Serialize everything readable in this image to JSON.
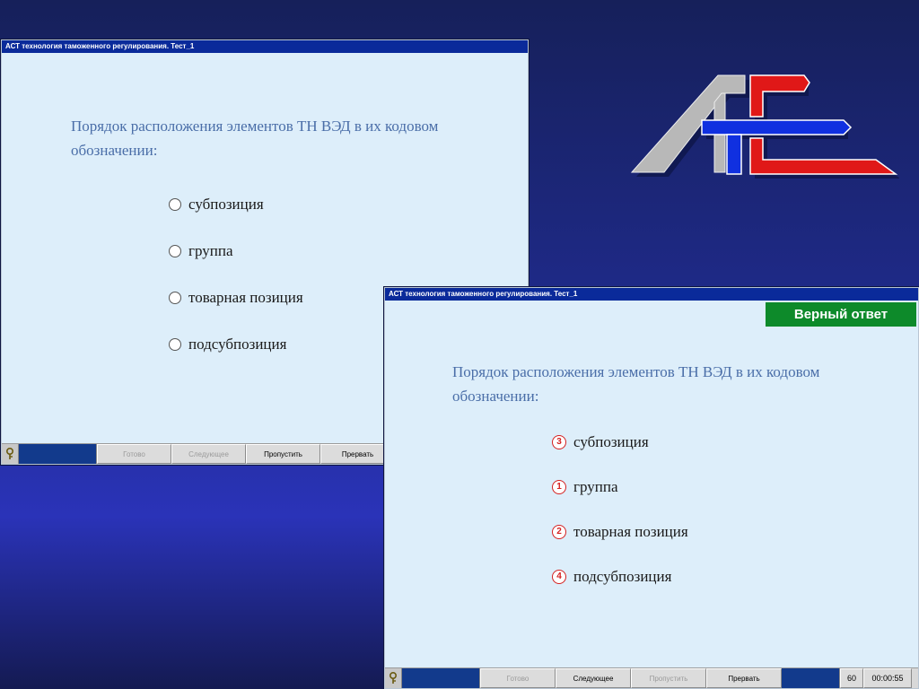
{
  "window1": {
    "title": "АСТ  технология таможенного регулирования. Тест_1",
    "question": "Порядок расположения элементов ТН ВЭД в их кодовом обозначении:",
    "options": [
      {
        "label": "субпозиция"
      },
      {
        "label": "группа"
      },
      {
        "label": "товарная позиция"
      },
      {
        "label": "подсубпозиция"
      }
    ],
    "statusbar": {
      "help_icon": "key-icon",
      "buttons": [
        {
          "label": "Готово",
          "enabled": false
        },
        {
          "label": "Следующее",
          "enabled": false
        },
        {
          "label": "Пропустить",
          "enabled": true
        },
        {
          "label": "Прервать",
          "enabled": true
        }
      ]
    }
  },
  "window2": {
    "title": "АСТ  технология таможенного регулирования. Тест_1",
    "result_banner": "Верный ответ",
    "question": "Порядок расположения элементов ТН ВЭД в их кодовом обозначении:",
    "options": [
      {
        "order": "3",
        "label": "субпозиция"
      },
      {
        "order": "1",
        "label": "группа"
      },
      {
        "order": "2",
        "label": "товарная позиция"
      },
      {
        "order": "4",
        "label": "подсубпозиция"
      }
    ],
    "statusbar": {
      "help_icon": "key-icon",
      "buttons": [
        {
          "label": "Готово",
          "enabled": false
        },
        {
          "label": "Следующее",
          "enabled": true
        },
        {
          "label": "Пропустить",
          "enabled": false
        },
        {
          "label": "Прервать",
          "enabled": true
        }
      ],
      "score": "60",
      "timer": "00:00:55"
    }
  },
  "logo": {
    "name": "ast-logo",
    "colors": {
      "gray": "#b8b8b8",
      "blue": "#1030e0",
      "red": "#e01818"
    }
  },
  "colors": {
    "title_bar": "#0a2a9a",
    "window_bg": "#ddeefa",
    "question_text": "#4a6ea8",
    "correct_banner": "#0d8a2a",
    "order_badge": "#d42020"
  }
}
